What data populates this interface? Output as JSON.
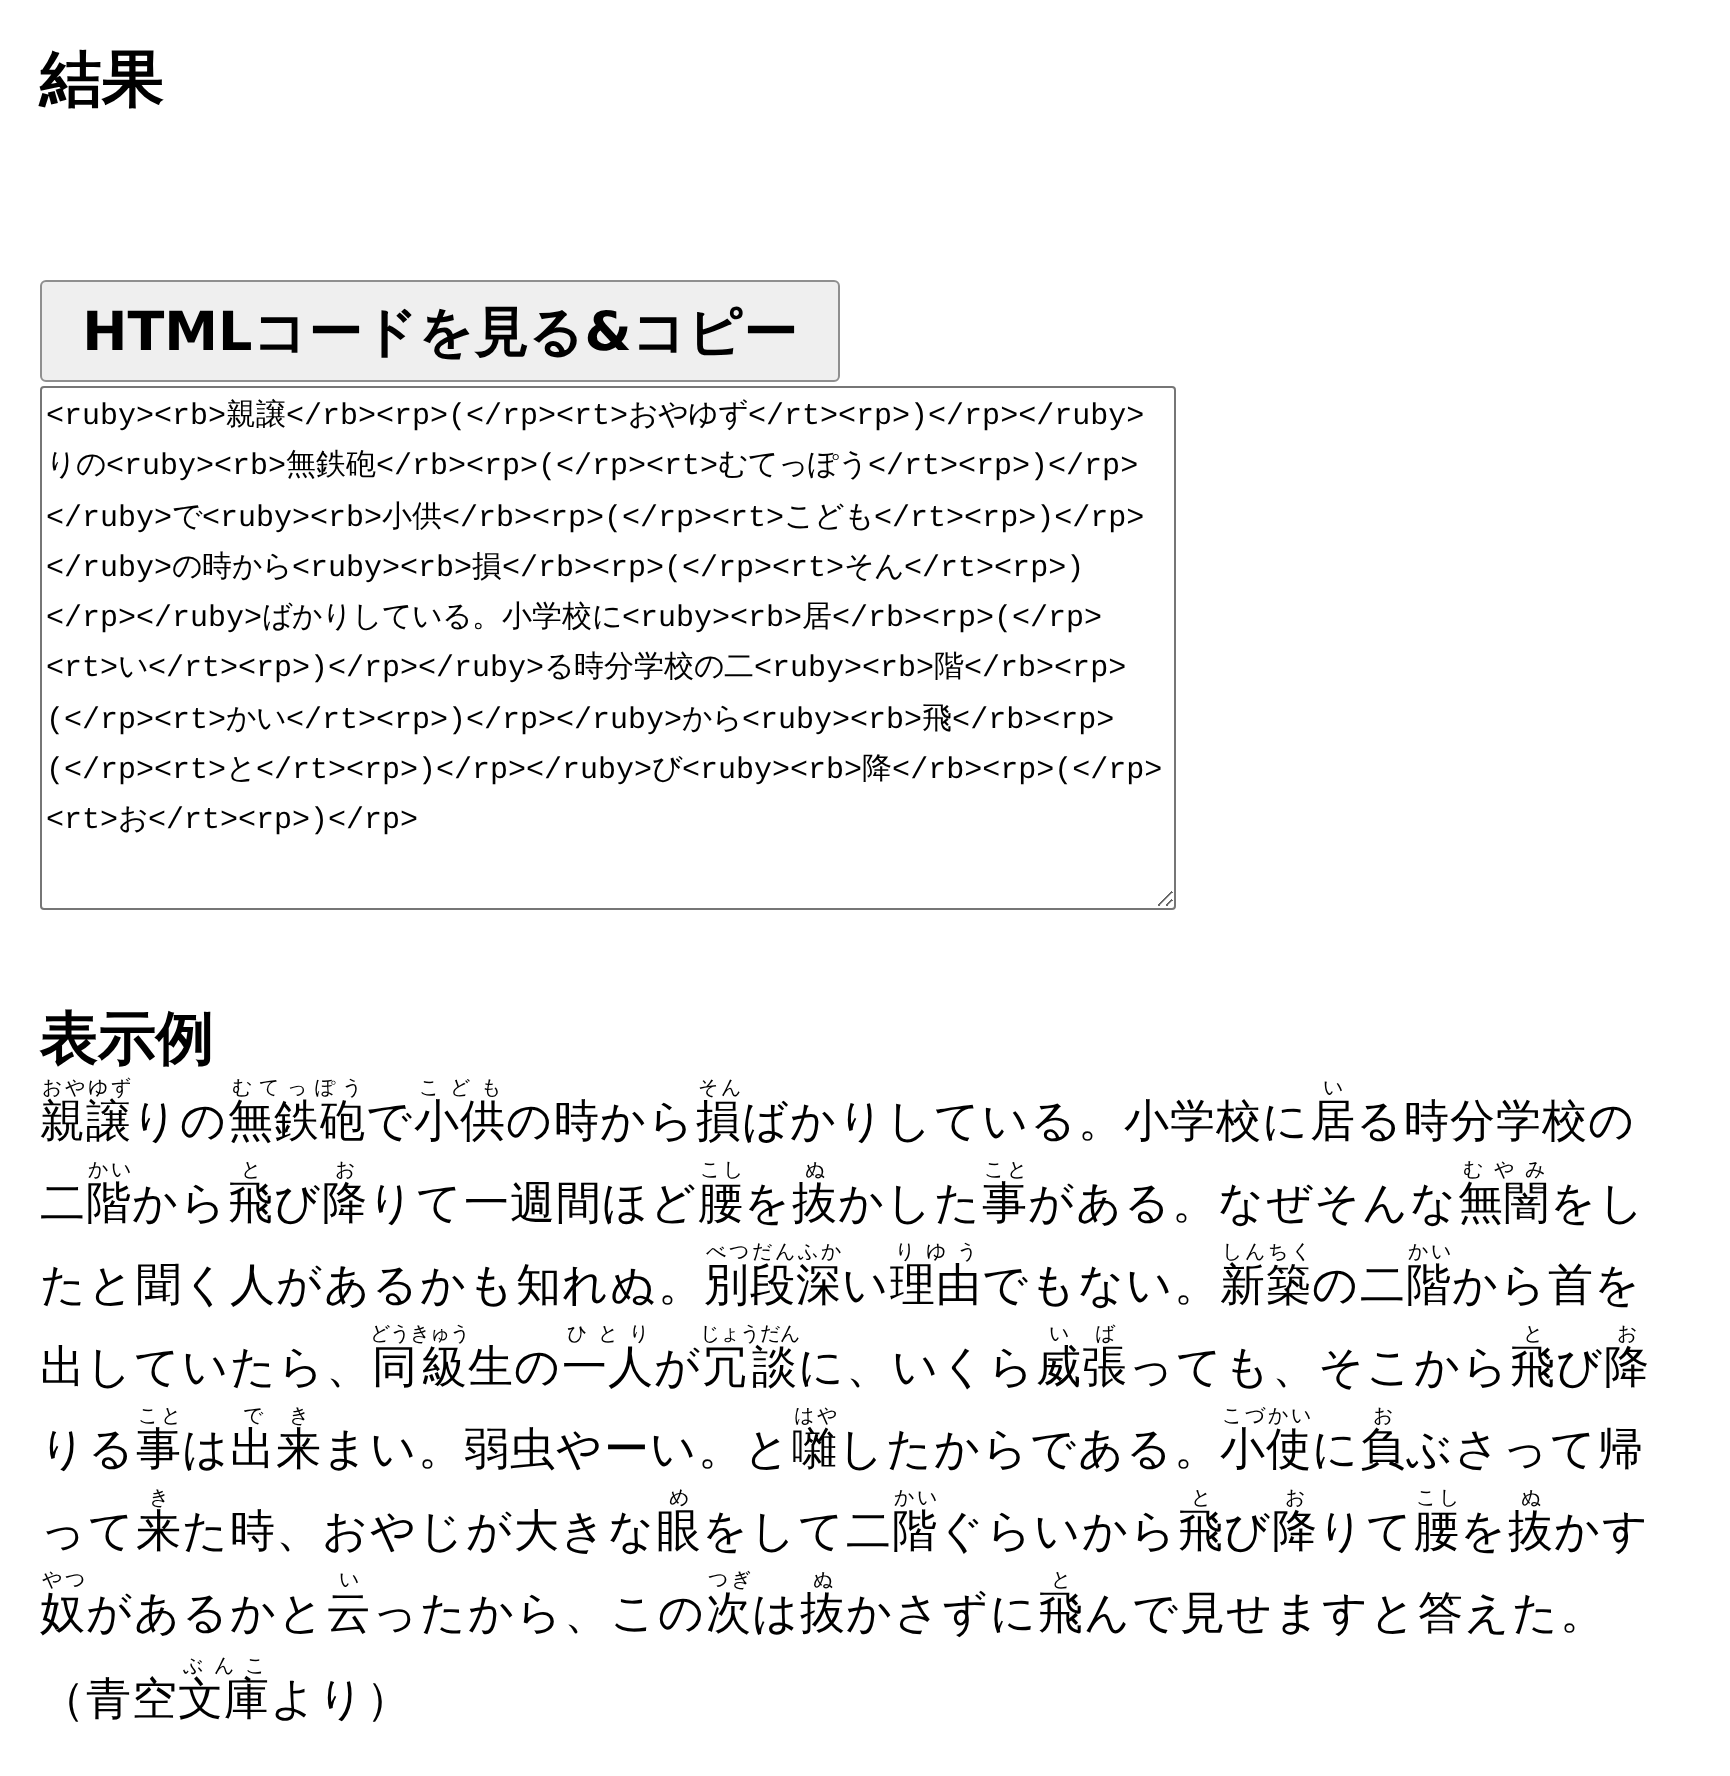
{
  "heading": "結果",
  "copy_button": "HTMLコードを見る&コピー",
  "code_box": {
    "value": "<ruby><rb>親譲</rb><rp>(</rp><rt>おやゆず</rt><rp>)</rp></ruby>りの<ruby><rb>無鉄砲</rb><rp>(</rp><rt>むてっぽう</rt><rp>)</rp></ruby>で<ruby><rb>小供</rb><rp>(</rp><rt>こども</rt><rp>)</rp></ruby>の時から<ruby><rb>損</rb><rp>(</rp><rt>そん</rt><rp>)</rp></ruby>ばかりしている。小学校に<ruby><rb>居</rb><rp>(</rp><rt>い</rt><rp>)</rp></ruby>る時分学校の二<ruby><rb>階</rb><rp>(</rp><rt>かい</rt><rp>)</rp></ruby>から<ruby><rb>飛</rb><rp>(</rp><rt>と</rt><rp>)</rp></ruby>び<ruby><rb>降</rb><rp>(</rp><rt>お</rt><rp>)</rp>"
  },
  "example_heading": "表示例",
  "paragraphs": [
    [
      {
        "kind": "ruby",
        "base": "親譲",
        "ruby": "おやゆず"
      },
      {
        "kind": "plain",
        "text": "りの"
      },
      {
        "kind": "ruby",
        "base": "無鉄砲",
        "ruby": "むてっぽう"
      },
      {
        "kind": "plain",
        "text": "で"
      },
      {
        "kind": "ruby",
        "base": "小供",
        "ruby": "こども"
      },
      {
        "kind": "plain",
        "text": "の時から"
      },
      {
        "kind": "ruby",
        "base": "損",
        "ruby": "そん"
      },
      {
        "kind": "plain",
        "text": "ばかりしている。小学校に"
      },
      {
        "kind": "ruby",
        "base": "居",
        "ruby": "い"
      },
      {
        "kind": "plain",
        "text": "る時分学校の二"
      },
      {
        "kind": "ruby",
        "base": "階",
        "ruby": "かい"
      },
      {
        "kind": "plain",
        "text": "から"
      },
      {
        "kind": "ruby",
        "base": "飛",
        "ruby": "と"
      },
      {
        "kind": "plain",
        "text": "び"
      },
      {
        "kind": "ruby",
        "base": "降",
        "ruby": "お"
      },
      {
        "kind": "plain",
        "text": "りて一週間ほど"
      },
      {
        "kind": "ruby",
        "base": "腰",
        "ruby": "こし"
      },
      {
        "kind": "plain",
        "text": "を"
      },
      {
        "kind": "ruby",
        "base": "抜",
        "ruby": "ぬ"
      },
      {
        "kind": "plain",
        "text": "かした"
      },
      {
        "kind": "ruby",
        "base": "事",
        "ruby": "こと"
      },
      {
        "kind": "plain",
        "text": "がある。なぜそんな"
      },
      {
        "kind": "ruby",
        "base": "無闇",
        "ruby": "むやみ"
      },
      {
        "kind": "plain",
        "text": "をしたと聞く人があるかも知れぬ。"
      },
      {
        "kind": "ruby",
        "base": "別段",
        "ruby": "べつだん"
      },
      {
        "kind": "ruby",
        "base": "深",
        "ruby": "ふか"
      },
      {
        "kind": "plain",
        "text": "い"
      },
      {
        "kind": "ruby",
        "base": "理由",
        "ruby": "りゆう"
      },
      {
        "kind": "plain",
        "text": "でもない。"
      },
      {
        "kind": "ruby",
        "base": "新築",
        "ruby": "しんちく"
      },
      {
        "kind": "plain",
        "text": "の二"
      },
      {
        "kind": "ruby",
        "base": "階",
        "ruby": "かい"
      },
      {
        "kind": "plain",
        "text": "から首を出していたら、"
      },
      {
        "kind": "ruby",
        "base": "同級",
        "ruby": "どうきゅう"
      },
      {
        "kind": "plain",
        "text": "生の"
      },
      {
        "kind": "ruby",
        "base": "一人",
        "ruby": "ひとり"
      },
      {
        "kind": "plain",
        "text": "が"
      },
      {
        "kind": "ruby",
        "base": "冗談",
        "ruby": "じょうだん"
      },
      {
        "kind": "plain",
        "text": "に、いくら"
      },
      {
        "kind": "ruby",
        "base": "威張",
        "ruby": "いば"
      },
      {
        "kind": "plain",
        "text": "っても、そこから"
      },
      {
        "kind": "ruby",
        "base": "飛",
        "ruby": "と"
      },
      {
        "kind": "plain",
        "text": "び"
      },
      {
        "kind": "ruby",
        "base": "降",
        "ruby": "お"
      },
      {
        "kind": "plain",
        "text": "りる"
      },
      {
        "kind": "ruby",
        "base": "事",
        "ruby": "こと"
      },
      {
        "kind": "plain",
        "text": "は"
      },
      {
        "kind": "ruby",
        "base": "出来",
        "ruby": "でき"
      },
      {
        "kind": "plain",
        "text": "まい。弱虫やーい。と"
      },
      {
        "kind": "ruby",
        "base": "囃",
        "ruby": "はや"
      },
      {
        "kind": "plain",
        "text": "したからである。"
      },
      {
        "kind": "ruby",
        "base": "小使",
        "ruby": "こづかい"
      },
      {
        "kind": "plain",
        "text": "に"
      },
      {
        "kind": "ruby",
        "base": "負",
        "ruby": "お"
      },
      {
        "kind": "plain",
        "text": "ぶさって帰って"
      },
      {
        "kind": "ruby",
        "base": "来",
        "ruby": "き"
      },
      {
        "kind": "plain",
        "text": "た時、おやじが大きな"
      },
      {
        "kind": "ruby",
        "base": "眼",
        "ruby": "め"
      },
      {
        "kind": "plain",
        "text": "をして二"
      },
      {
        "kind": "ruby",
        "base": "階",
        "ruby": "かい"
      },
      {
        "kind": "plain",
        "text": "ぐらいから"
      },
      {
        "kind": "ruby",
        "base": "飛",
        "ruby": "と"
      },
      {
        "kind": "plain",
        "text": "び"
      },
      {
        "kind": "ruby",
        "base": "降",
        "ruby": "お"
      },
      {
        "kind": "plain",
        "text": "りて"
      },
      {
        "kind": "ruby",
        "base": "腰",
        "ruby": "こし"
      },
      {
        "kind": "plain",
        "text": "を"
      },
      {
        "kind": "ruby",
        "base": "抜",
        "ruby": "ぬ"
      },
      {
        "kind": "plain",
        "text": "かす"
      },
      {
        "kind": "ruby",
        "base": "奴",
        "ruby": "やつ"
      },
      {
        "kind": "plain",
        "text": "があるかと"
      },
      {
        "kind": "ruby",
        "base": "云",
        "ruby": "い"
      },
      {
        "kind": "plain",
        "text": "ったから、この"
      },
      {
        "kind": "ruby",
        "base": "次",
        "ruby": "つぎ"
      },
      {
        "kind": "plain",
        "text": "は"
      },
      {
        "kind": "ruby",
        "base": "抜",
        "ruby": "ぬ"
      },
      {
        "kind": "plain",
        "text": "かさずに"
      },
      {
        "kind": "ruby",
        "base": "飛",
        "ruby": "と"
      },
      {
        "kind": "plain",
        "text": "んで見せますと答えた。"
      }
    ],
    [
      {
        "kind": "plain",
        "text": "（青空"
      },
      {
        "kind": "ruby",
        "base": "文庫",
        "ruby": "ぶんこ"
      },
      {
        "kind": "plain",
        "text": "より）"
      }
    ]
  ]
}
